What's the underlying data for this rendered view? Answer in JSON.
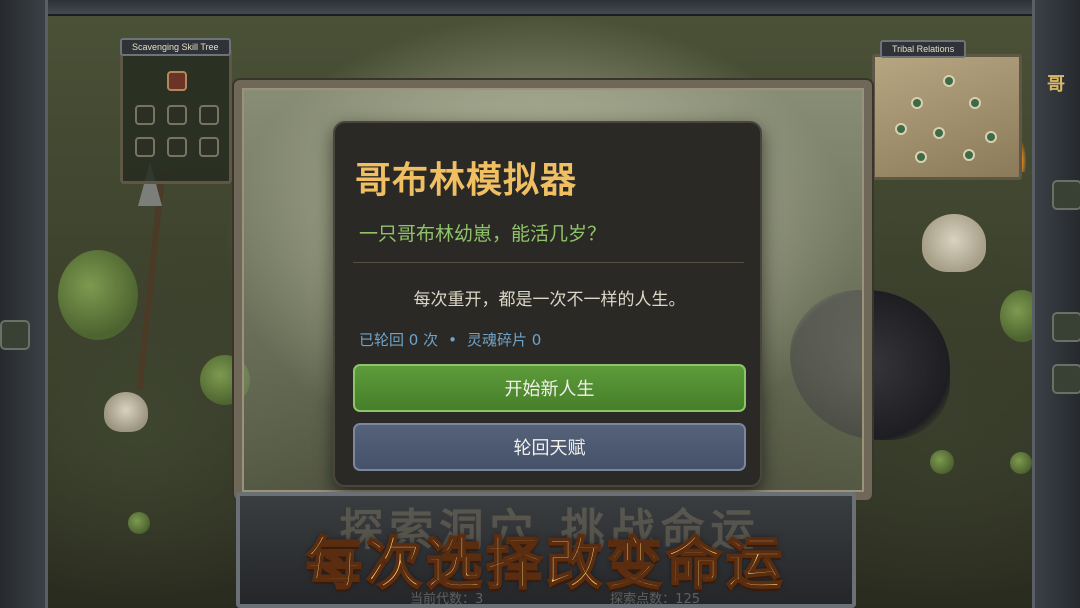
{
  "skill_tree": {
    "label": "Scavenging Skill Tree"
  },
  "tribal_relations": {
    "label": "Tribal Relations"
  },
  "right_frame": {
    "text": "哥"
  },
  "dialog": {
    "title": "哥布林模拟器",
    "subtitle": "一只哥布林幼崽，能活几岁？",
    "description": "每次重开，都是一次不一样的人生。",
    "stats": {
      "rebirths": "已轮回 0 次",
      "separator": "•",
      "soul_shards": "灵魂碎片 0"
    },
    "start_button": "开始新人生",
    "talent_button": "轮回天赋"
  },
  "banner": {
    "headline": "每次选择改变命运",
    "background_text": "探索洞穴 挑战命运",
    "footer_left": "当前代数：3",
    "footer_right": "探索点数：125"
  },
  "colors": {
    "title": "#efbf62",
    "subtitle": "#8fc36a",
    "stats": "#6fa3c8",
    "start_button": "#5d9b3a",
    "talent_button": "#55627a",
    "banner_text": "#f6d47a"
  }
}
